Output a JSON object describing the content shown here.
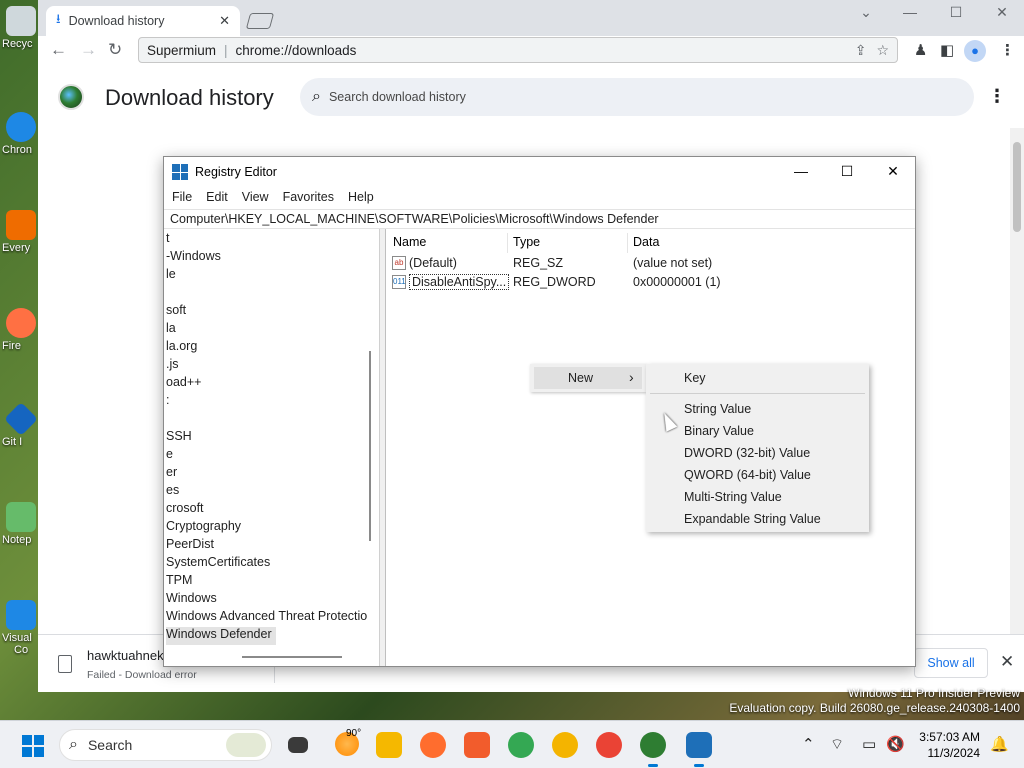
{
  "desktop": {
    "icons": [
      {
        "label": "Recyc",
        "color": "#cfd8dc"
      },
      {
        "label": "Chron",
        "color": "#1e88e5"
      },
      {
        "label": "Every",
        "color": "#ef6c00"
      },
      {
        "label": "Fire",
        "color": "#ff7043"
      },
      {
        "label": "Git I",
        "color": "#1565c0"
      },
      {
        "label": "Notep",
        "color": "#66bb6a"
      },
      {
        "label": "Visual",
        "color": "#1e88e5"
      },
      {
        "label": "Co",
        "color": "#1e88e5"
      }
    ]
  },
  "chrome": {
    "tab_title": "Download history",
    "tab_icon": "download-icon",
    "omnibox_brand": "Supermium",
    "omnibox_url": "chrome://downloads",
    "page_title": "Download history",
    "search_placeholder": "Search download history",
    "download_item": {
      "name": "hawktuahnek",
      "status": "Failed - Download error"
    },
    "show_all_label": "Show all",
    "colors": {
      "accent": "#1a73e8",
      "tabstrip": "#dee1e6"
    }
  },
  "regedit": {
    "title": "Registry Editor",
    "menu": [
      "File",
      "Edit",
      "View",
      "Favorites",
      "Help"
    ],
    "address": "Computer\\HKEY_LOCAL_MACHINE\\SOFTWARE\\Policies\\Microsoft\\Windows Defender",
    "tree": [
      "t",
      "-Windows",
      "le",
      "",
      "soft",
      "la",
      "la.org",
      ".js",
      "oad++",
      ":",
      "",
      "SSH",
      "e",
      "er",
      "es",
      "crosoft",
      "Cryptography",
      "PeerDist",
      "SystemCertificates",
      "TPM",
      "Windows",
      "Windows Advanced Threat Protectio",
      "Windows Defender"
    ],
    "selected_tree_item": "Windows Defender",
    "columns": {
      "name": "Name",
      "type": "Type",
      "data": "Data"
    },
    "values": [
      {
        "icon": "ab",
        "name": "(Default)",
        "type": "REG_SZ",
        "data": "(value not set)"
      },
      {
        "icon": "011",
        "name": "DisableAntiSpy...",
        "type": "REG_DWORD",
        "data": "0x00000001 (1)"
      }
    ]
  },
  "context_menu": {
    "parent_label": "New",
    "submenu": [
      "Key",
      "String Value",
      "Binary Value",
      "DWORD (32-bit) Value",
      "QWORD (64-bit) Value",
      "Multi-String Value",
      "Expandable String Value"
    ]
  },
  "watermark": {
    "line1": "Windows 11 Pro Insider Preview",
    "line2": "Evaluation copy. Build 26080.ge_release.240308-1400"
  },
  "taskbar": {
    "search_label": "Search",
    "weather_temp": "90°",
    "time": "3:57:03 AM",
    "date": "11/3/2024",
    "apps": [
      {
        "name": "task-view",
        "color": "#3a3a3a"
      },
      {
        "name": "file-explorer",
        "color": "#f5b800"
      },
      {
        "name": "firefox",
        "color": "#ff6d2e"
      },
      {
        "name": "brave",
        "color": "#f25c2c"
      },
      {
        "name": "chrome",
        "color": "#34a853"
      },
      {
        "name": "chrome-canary",
        "color": "#f4b400"
      },
      {
        "name": "chrome-2",
        "color": "#ea4335"
      },
      {
        "name": "supermium",
        "color": "#2e7d32"
      },
      {
        "name": "registry-editor",
        "color": "#1e6fb8"
      }
    ]
  }
}
